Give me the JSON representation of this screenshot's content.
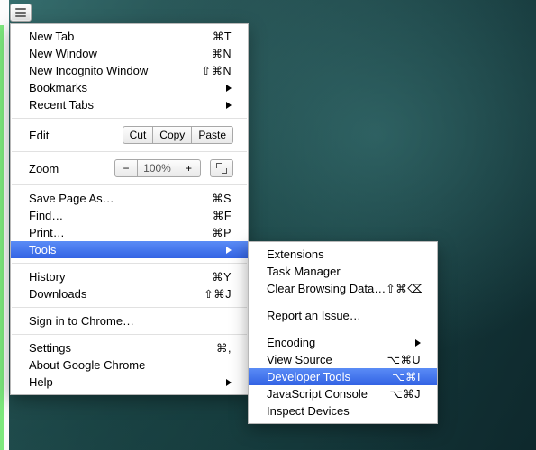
{
  "main_menu": {
    "new_tab": {
      "label": "New Tab",
      "shortcut": "⌘T"
    },
    "new_window": {
      "label": "New Window",
      "shortcut": "⌘N"
    },
    "new_incognito": {
      "label": "New Incognito Window",
      "shortcut": "⇧⌘N"
    },
    "bookmarks": {
      "label": "Bookmarks"
    },
    "recent_tabs": {
      "label": "Recent Tabs"
    },
    "edit": {
      "label": "Edit",
      "cut": "Cut",
      "copy": "Copy",
      "paste": "Paste"
    },
    "zoom": {
      "label": "Zoom",
      "minus": "−",
      "pct": "100%",
      "plus": "+"
    },
    "save_page": {
      "label": "Save Page As…",
      "shortcut": "⌘S"
    },
    "find": {
      "label": "Find…",
      "shortcut": "⌘F"
    },
    "print": {
      "label": "Print…",
      "shortcut": "⌘P"
    },
    "tools": {
      "label": "Tools"
    },
    "history": {
      "label": "History",
      "shortcut": "⌘Y"
    },
    "downloads": {
      "label": "Downloads",
      "shortcut": "⇧⌘J"
    },
    "sign_in": {
      "label": "Sign in to Chrome…"
    },
    "settings": {
      "label": "Settings",
      "shortcut": "⌘,"
    },
    "about": {
      "label": "About Google Chrome"
    },
    "help": {
      "label": "Help"
    }
  },
  "tools_submenu": {
    "extensions": {
      "label": "Extensions"
    },
    "task_manager": {
      "label": "Task Manager"
    },
    "clear_data": {
      "label": "Clear Browsing Data…",
      "shortcut": "⇧⌘⌫"
    },
    "report_issue": {
      "label": "Report an Issue…"
    },
    "encoding": {
      "label": "Encoding"
    },
    "view_source": {
      "label": "View Source",
      "shortcut": "⌥⌘U"
    },
    "developer_tools": {
      "label": "Developer Tools",
      "shortcut": "⌥⌘I"
    },
    "js_console": {
      "label": "JavaScript Console",
      "shortcut": "⌥⌘J"
    },
    "inspect_devices": {
      "label": "Inspect Devices"
    }
  }
}
